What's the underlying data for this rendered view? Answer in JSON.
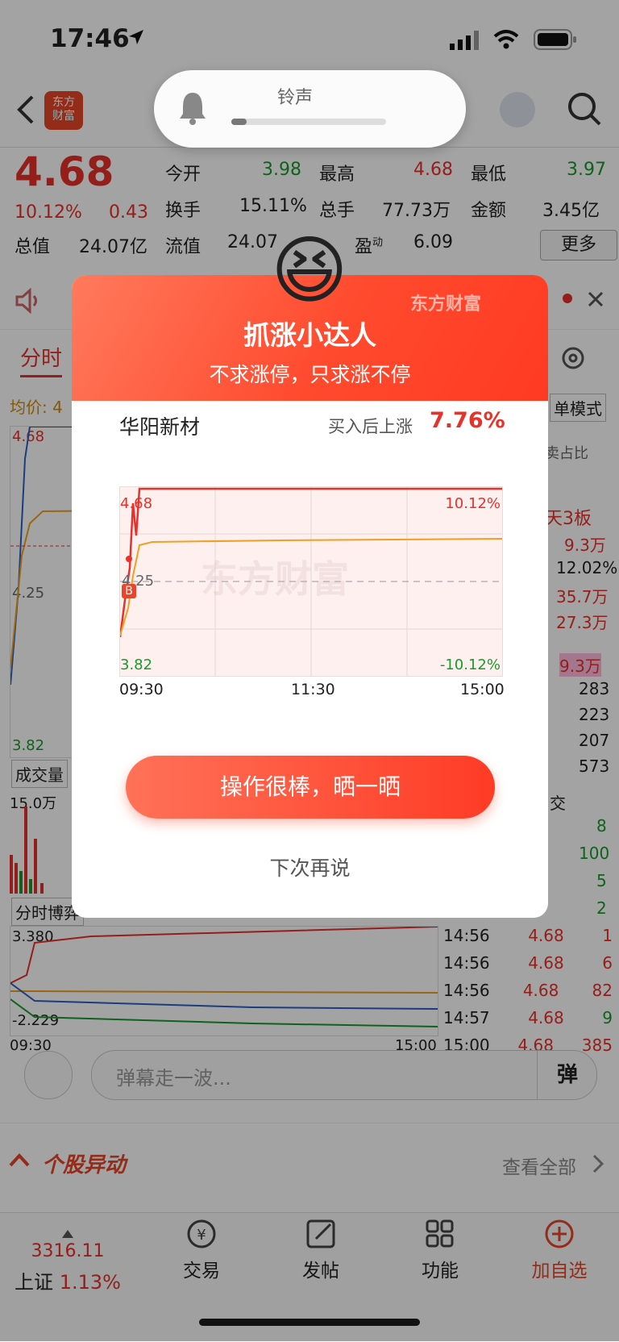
{
  "status_bar": {
    "time": "17:46"
  },
  "volume_toast": {
    "label": "铃声",
    "level": 0.1
  },
  "header": {
    "logo_text": "东方\n财富"
  },
  "quote": {
    "price": "4.68",
    "change_pct": "10.12%",
    "change_abs": "0.43",
    "open_label": "今开",
    "open_value": "3.98",
    "high_label": "最高",
    "high_value": "4.68",
    "low_label": "最低",
    "low_value": "3.97",
    "turnover_label": "换手",
    "turnover_value": "15.11%",
    "volume_label": "总手",
    "volume_value": "77.73万",
    "amount_label": "金额",
    "amount_value": "3.45亿",
    "mktcap_label": "总值",
    "mktcap_value": "24.07亿",
    "float_label": "流值",
    "float_value": "24.07",
    "pe_label": "盈",
    "pe_sup": "动",
    "pe_value": "6.09",
    "more_button": "更多"
  },
  "tabs": {
    "timeshare": "分时",
    "avg_price": "均价: 4"
  },
  "bg_chart": {
    "top_price": "4.68",
    "mid_price": "4.25",
    "low_price": "3.82",
    "volume_tab": "成交量",
    "volume_max": "15.0万",
    "game_tab": "分时博弈",
    "game_top": "3.380",
    "game_bottom": "-2.229",
    "t_start": "09:30",
    "t_end": "15:00"
  },
  "right_panel": {
    "single_mode": "单模式",
    "ratio": "卖占比",
    "board": "天3板",
    "values": [
      "9.3万",
      "12.02%",
      "35.7万",
      "27.3万"
    ],
    "bid": [
      "9.3万",
      "283",
      "223",
      "207",
      "573"
    ],
    "deal": "交",
    "deal_vols": [
      "8",
      "100",
      "5",
      "2"
    ],
    "trades": [
      {
        "t": "14:56",
        "p": "4.68",
        "v": "1"
      },
      {
        "t": "14:56",
        "p": "4.68",
        "v": "6"
      },
      {
        "t": "14:56",
        "p": "4.68",
        "v": "82"
      },
      {
        "t": "14:57",
        "p": "4.68",
        "v": "9"
      },
      {
        "t": "15:00",
        "p": "4.68",
        "v": "385"
      }
    ]
  },
  "modal": {
    "emoji": "😆",
    "watermark": "东方财富",
    "title": "抓涨小达人",
    "subtitle": "不求涨停，只求涨不停",
    "stock_name": "华阳新材",
    "gain_label": "买入后上涨",
    "gain_value": "7.76%",
    "chart": {
      "top_price": "4.68",
      "mid_price": "4.25",
      "low_price": "3.82",
      "top_pct": "10.12%",
      "low_pct": "-10.12%",
      "times": [
        "09:30",
        "11:30",
        "15:00"
      ],
      "buy_marker": "B",
      "watermark": "东方财富"
    },
    "share_button": "操作很棒，晒一晒",
    "later_link": "下次再说"
  },
  "danmu": {
    "placeholder": "弹幕走一波...",
    "button": "弹"
  },
  "movement": {
    "title": "个股异动",
    "see_all": "查看全部"
  },
  "index": {
    "value": "3316.11",
    "name": "上证",
    "pct": "1.13%"
  },
  "nav": [
    "交易",
    "发帖",
    "功能",
    "加自选"
  ],
  "colors": {
    "up": "#e8312a",
    "down": "#1a9a2a",
    "accent": "#ff4a2e"
  }
}
